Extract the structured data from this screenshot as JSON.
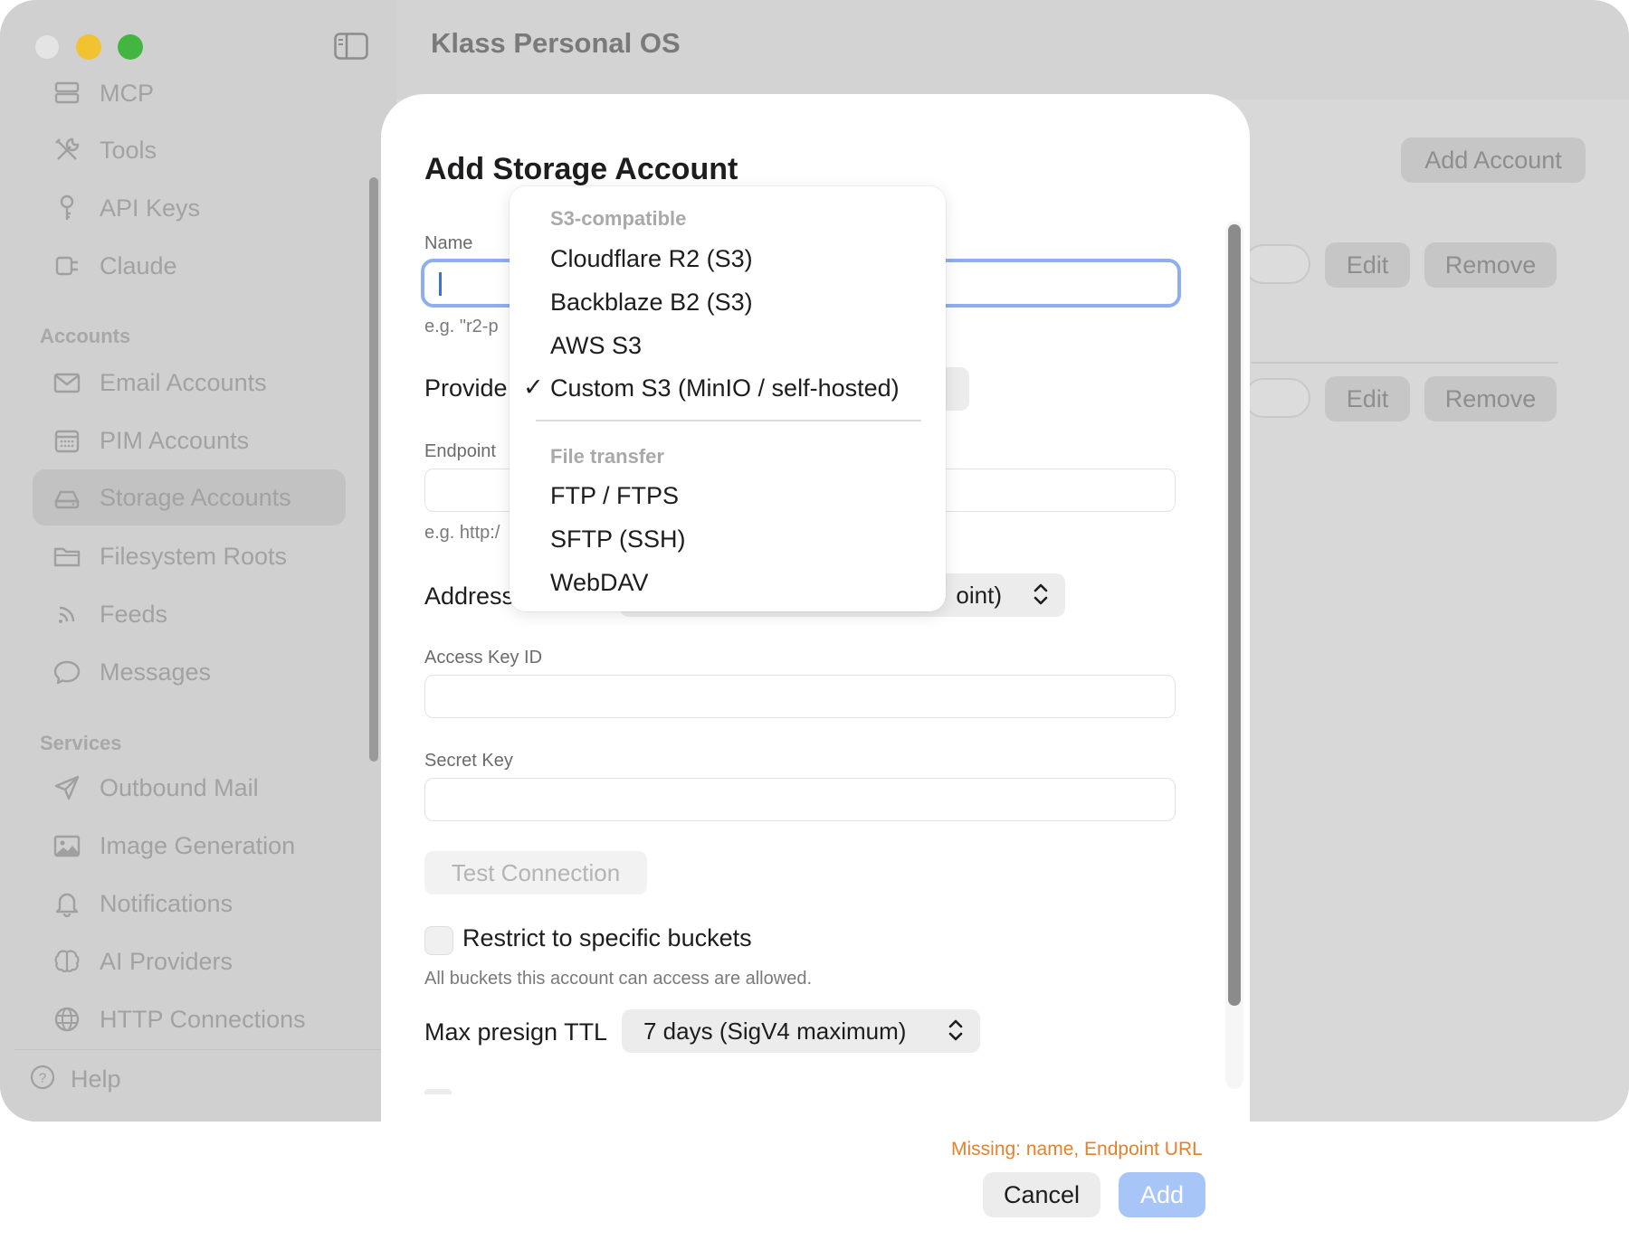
{
  "window": {
    "title": "Klass Personal OS"
  },
  "sidebar": {
    "top_items": [
      {
        "label": "MCP",
        "icon": "server-icon"
      },
      {
        "label": "Tools",
        "icon": "tools-icon"
      },
      {
        "label": "API Keys",
        "icon": "key-icon"
      },
      {
        "label": "Claude",
        "icon": "plug-icon"
      }
    ],
    "accounts_header": "Accounts",
    "account_items": [
      {
        "label": "Email Accounts",
        "icon": "envelope-icon"
      },
      {
        "label": "PIM Accounts",
        "icon": "calendar-icon"
      },
      {
        "label": "Storage Accounts",
        "icon": "drive-icon",
        "selected": true
      },
      {
        "label": "Filesystem Roots",
        "icon": "folder-icon"
      },
      {
        "label": "Feeds",
        "icon": "rss-icon"
      },
      {
        "label": "Messages",
        "icon": "chat-bubble-icon"
      }
    ],
    "services_header": "Services",
    "service_items": [
      {
        "label": "Outbound Mail",
        "icon": "paper-plane-icon"
      },
      {
        "label": "Image Generation",
        "icon": "photo-icon"
      },
      {
        "label": "Notifications",
        "icon": "bell-icon"
      },
      {
        "label": "AI Providers",
        "icon": "brain-icon"
      },
      {
        "label": "HTTP Connections",
        "icon": "globe-icon"
      }
    ],
    "help_label": "Help"
  },
  "background": {
    "add_account_label": "Add Account",
    "edit_label": "Edit",
    "remove_label": "Remove"
  },
  "modal": {
    "title": "Add Storage Account",
    "name_label": "Name",
    "name_value": "",
    "name_hint": "e.g. \"r2-p",
    "provider_label": "Provide",
    "endpoint_label": "Endpoint",
    "endpoint_hint": "e.g. http:/",
    "address_label": "Address",
    "address_value": "oint)",
    "access_key_label": "Access Key ID",
    "secret_key_label": "Secret Key",
    "test_connection_label": "Test Connection",
    "restrict_label": "Restrict to specific buckets",
    "restrict_hint": "All buckets this account can access are allowed.",
    "ttl_label": "Max presign TTL",
    "ttl_value": "7 days (SigV4 maximum)",
    "missing_text": "Missing: name, Endpoint URL",
    "cancel_label": "Cancel",
    "add_label": "Add"
  },
  "dropdown": {
    "group1_header": "S3-compatible",
    "group1_items": [
      "Cloudflare R2 (S3)",
      "Backblaze B2 (S3)",
      "AWS S3",
      "Custom S3 (MinIO / self-hosted)"
    ],
    "selected_item": "Custom S3 (MinIO / self-hosted)",
    "check_mark": "✓",
    "group2_header": "File transfer",
    "group2_items": [
      "FTP / FTPS",
      "SFTP (SSH)",
      "WebDAV"
    ]
  },
  "colors": {
    "accent": "#3a6fe0",
    "focus_ring": "#8eaef0",
    "warning": "#e2822e",
    "add_button_disabled": "#a7c6f7",
    "traffic_min": "#f2c230",
    "traffic_max": "#43b641"
  }
}
